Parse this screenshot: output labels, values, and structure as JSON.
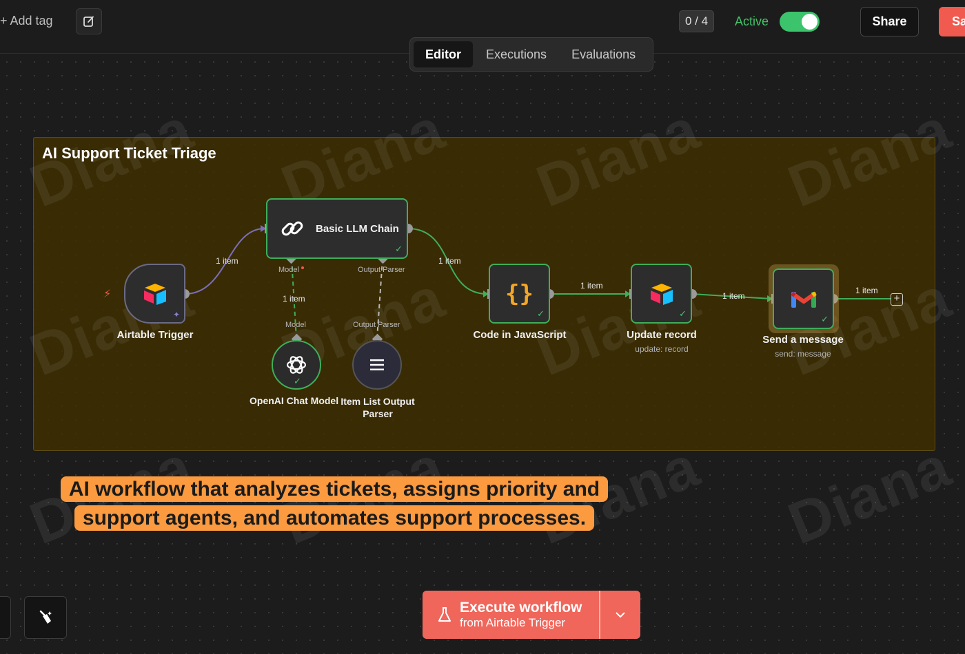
{
  "header": {
    "add_tag": "+ Add tag",
    "counter": "0 / 4",
    "active_label": "Active",
    "active": true,
    "share_label": "Share",
    "save_label": "Sa"
  },
  "tabs": [
    {
      "label": "Editor",
      "active": true
    },
    {
      "label": "Executions",
      "active": false
    },
    {
      "label": "Evaluations",
      "active": false
    }
  ],
  "sticky": {
    "title": "AI Support Ticket Triage"
  },
  "watermark": "Diana",
  "nodes": {
    "trigger": {
      "label": "Airtable Trigger",
      "icon": "airtable-icon"
    },
    "llm_chain": {
      "label": "Basic LLM Chain",
      "icon": "link-icon",
      "port_model": "Model",
      "port_parser": "Output Parser"
    },
    "openai": {
      "label": "OpenAI Chat Model",
      "port": "Model",
      "icon": "openai-icon"
    },
    "parser": {
      "label": "Item List Output Parser",
      "port": "Output Parser",
      "icon": "list-icon"
    },
    "code": {
      "label": "Code in JavaScript",
      "icon": "braces-icon"
    },
    "update": {
      "label": "Update record",
      "sublabel": "update: record",
      "icon": "airtable-icon"
    },
    "gmail": {
      "label": "Send a message",
      "sublabel": "send: message",
      "icon": "gmail-icon"
    }
  },
  "edges": {
    "trigger_llm": "1 item",
    "model_llm": "1 item",
    "llm_code": "1 item",
    "code_update": "1 item",
    "update_gmail": "1 item",
    "gmail_out": "1 item"
  },
  "caption": "AI workflow that analyzes tickets, assigns priority and support agents, and automates support processes.",
  "execute": {
    "line1": "Execute workflow",
    "line2": "from Airtable Trigger"
  },
  "colors": {
    "accent": "#f0665b",
    "active": "#3bc46b",
    "sticky": "#3f2f00",
    "caption_bg": "#fb9a3f"
  }
}
